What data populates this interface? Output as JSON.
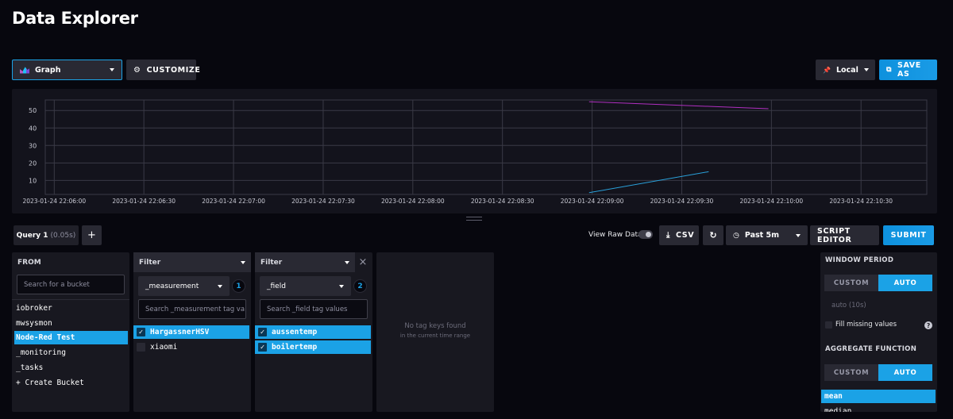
{
  "page": {
    "title": "Data Explorer"
  },
  "toolbar": {
    "graph_type": "Graph",
    "customize": "CUSTOMIZE",
    "timezone": "Local",
    "save_as": "SAVE AS"
  },
  "colors": {
    "accent": "#1ba2e6",
    "series_purple": "#b02fc0",
    "series_blue": "#2aa2dc"
  },
  "chart_data": {
    "type": "line",
    "x_ticks": [
      "2023-01-24 22:06:00",
      "2023-01-24 22:06:30",
      "2023-01-24 22:07:00",
      "2023-01-24 22:07:30",
      "2023-01-24 22:08:00",
      "2023-01-24 22:08:30",
      "2023-01-24 22:09:00",
      "2023-01-24 22:09:30",
      "2023-01-24 22:10:00",
      "2023-01-24 22:10:30"
    ],
    "y_ticks": [
      "10",
      "20",
      "30",
      "40",
      "50"
    ],
    "ylim": [
      2,
      56
    ],
    "xlim": [
      "2023-01-24 22:05:57",
      "2023-01-24 22:10:52"
    ],
    "grid": true,
    "series": [
      {
        "color": "#b02fc0",
        "points": [
          {
            "x": "2023-01-24 22:08:59",
            "y": 55
          },
          {
            "x": "2023-01-24 22:09:59",
            "y": 51
          }
        ]
      },
      {
        "color": "#2aa2dc",
        "points": [
          {
            "x": "2023-01-24 22:08:59",
            "y": 3
          },
          {
            "x": "2023-01-24 22:09:39",
            "y": 15
          }
        ]
      }
    ]
  },
  "query": {
    "tab_label": "Query 1",
    "tab_time": "(0.05s)",
    "add_label": "+",
    "view_raw": "View Raw Data",
    "csv": "CSV",
    "time_range": "Past 5m",
    "script_editor": "SCRIPT EDITOR",
    "submit": "SUBMIT"
  },
  "from_panel": {
    "header": "FROM",
    "search_placeholder": "Search for a bucket",
    "buckets": [
      "iobroker",
      "mwsysmon",
      "Node-Red Test",
      "_monitoring",
      "_tasks",
      "+ Create Bucket"
    ]
  },
  "filter1": {
    "header": "Filter",
    "key": "_measurement",
    "badge": "1",
    "search_placeholder": "Search _measurement tag va",
    "values": [
      "HargassnerHSV",
      "xiaomi"
    ]
  },
  "filter2": {
    "header": "Filter",
    "close": "×",
    "key": "_field",
    "badge": "2",
    "search_placeholder": "Search _field tag values",
    "values": [
      "aussentemp",
      "boilertemp"
    ]
  },
  "filter3": {
    "empty_title": "No tag keys found",
    "empty_sub": "in the current time range"
  },
  "aggregate": {
    "window_period": "WINDOW PERIOD",
    "custom": "CUSTOM",
    "auto": "AUTO",
    "auto_value": "auto (10s)",
    "fill_missing": "Fill missing values",
    "help": "?",
    "aggregate_function": "AGGREGATE FUNCTION",
    "functions": [
      "mean",
      "median"
    ]
  }
}
